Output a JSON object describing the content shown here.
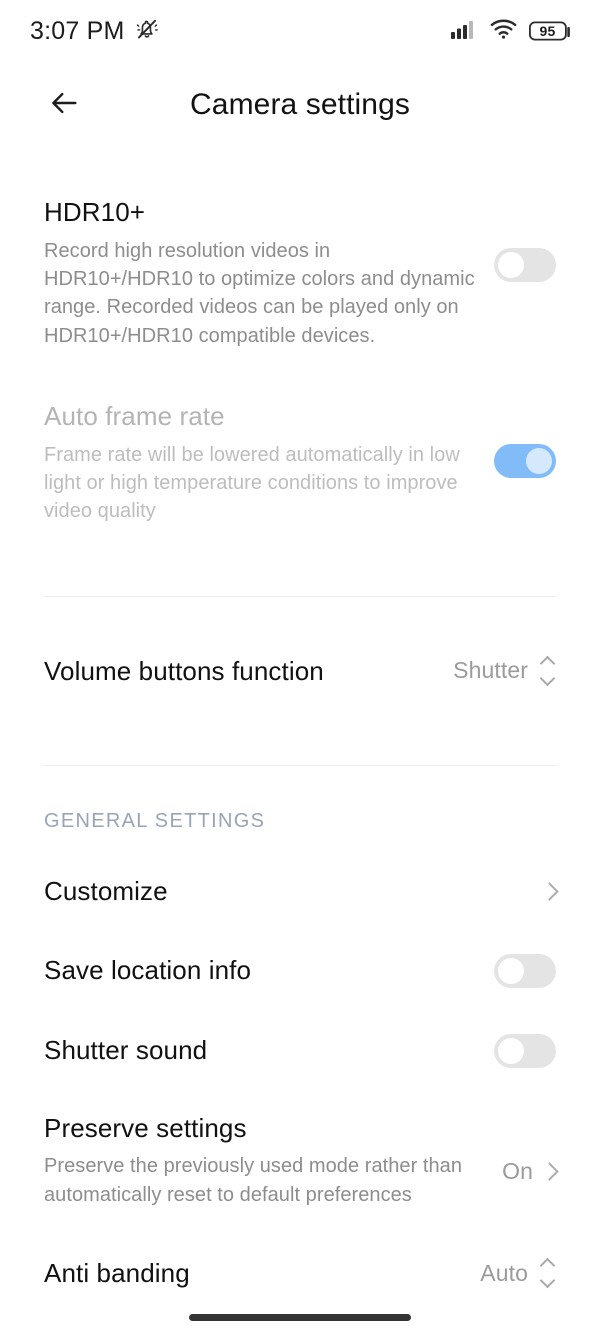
{
  "status_bar": {
    "time": "3:07 PM",
    "silent_icon": "bell-slash-icon",
    "signal_icon": "cellular-signal-icon",
    "wifi_icon": "wifi-icon",
    "battery_level": "95"
  },
  "header": {
    "back_icon": "back-arrow-icon",
    "title": "Camera settings"
  },
  "settings": {
    "hdr10": {
      "title": "HDR10+",
      "description": "Record high resolution videos in HDR10+/HDR10 to optimize colors and dynamic range. Recorded videos can be played only on HDR10+/HDR10 compatible devices.",
      "toggle_state": "off"
    },
    "auto_frame_rate": {
      "title": "Auto frame rate",
      "description": "Frame rate will be lowered automatically in low light or high temperature conditions to improve video quality",
      "toggle_state": "on",
      "disabled": "true"
    },
    "volume_buttons": {
      "title": "Volume buttons function",
      "value": "Shutter",
      "control_icon": "chevron-up-down-icon"
    }
  },
  "general_settings": {
    "section_label": "GENERAL SETTINGS",
    "customize": {
      "title": "Customize",
      "control_icon": "chevron-right-icon"
    },
    "save_location": {
      "title": "Save location info",
      "toggle_state": "off"
    },
    "shutter_sound": {
      "title": "Shutter sound",
      "toggle_state": "off"
    },
    "preserve_settings": {
      "title": "Preserve settings",
      "description": "Preserve the previously used mode rather than automatically reset to default preferences",
      "value": "On",
      "control_icon": "chevron-right-icon"
    },
    "anti_banding": {
      "title": "Anti banding",
      "value": "Auto",
      "control_icon": "chevron-up-down-icon"
    }
  },
  "colors": {
    "toggle_on": "#82bcf8",
    "toggle_off": "#e4e4e4",
    "section_label": "#9aa3b8",
    "value_text": "#9b9b9b"
  },
  "navigation": {
    "home_indicator": "home-indicator"
  }
}
